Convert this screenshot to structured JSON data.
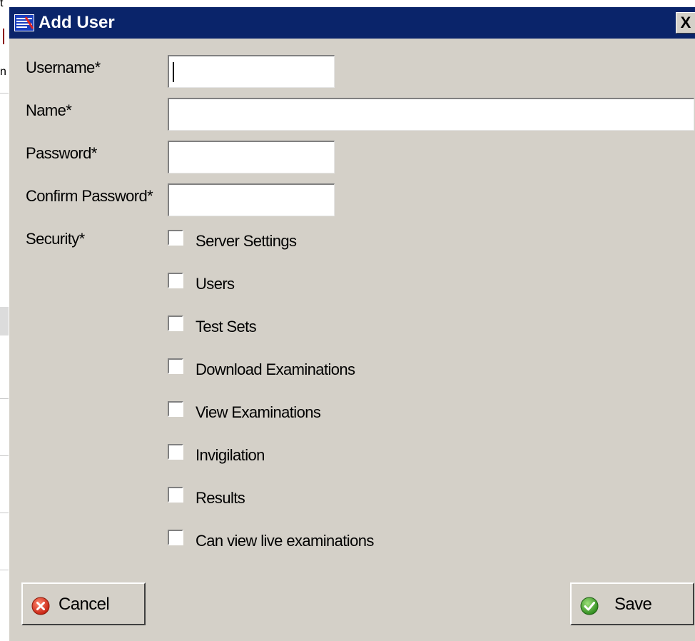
{
  "dialog": {
    "title": "Add User",
    "close_label": "X",
    "colors": {
      "titlebar": "#0a246a",
      "face": "#d4d0c8"
    }
  },
  "fields": {
    "username_label": "Username*",
    "username_value": "",
    "name_label": "Name*",
    "name_value": "",
    "password_label": "Password*",
    "password_value": "",
    "confirm_label": "Confirm Password*",
    "confirm_value": "",
    "security_label": "Security*"
  },
  "security_options": [
    {
      "label": "Server Settings",
      "checked": false
    },
    {
      "label": "Users",
      "checked": false
    },
    {
      "label": "Test Sets",
      "checked": false
    },
    {
      "label": "Download Examinations",
      "checked": false
    },
    {
      "label": "View Examinations",
      "checked": false
    },
    {
      "label": "Invigilation",
      "checked": false
    },
    {
      "label": "Results",
      "checked": false
    },
    {
      "label": "Can view live examinations",
      "checked": false
    }
  ],
  "buttons": {
    "cancel_label": "Cancel",
    "cancel_icon": "cancel-x-icon",
    "save_label": "Save",
    "save_icon": "checkmark-icon"
  },
  "background": {
    "fragments": [
      "t",
      "n"
    ]
  }
}
